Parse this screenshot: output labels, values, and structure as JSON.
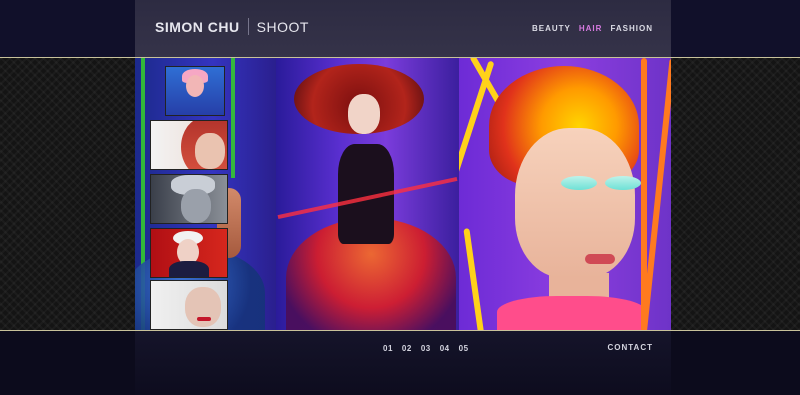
{
  "header": {
    "brand_name": "SIMON CHU",
    "page_title": "SHOOT",
    "nav": [
      {
        "label": "BEAUTY",
        "active": false
      },
      {
        "label": "HAIR",
        "active": true
      },
      {
        "label": "FASHION",
        "active": false
      }
    ]
  },
  "footer": {
    "pages": [
      "01",
      "02",
      "03",
      "04",
      "05"
    ],
    "contact_label": "CONTACT"
  },
  "colors": {
    "accent": "#d67ae0",
    "header_bg": "#2f2d45",
    "page_bg": "#0c0b1c",
    "stage_border": "#c8c29a"
  }
}
